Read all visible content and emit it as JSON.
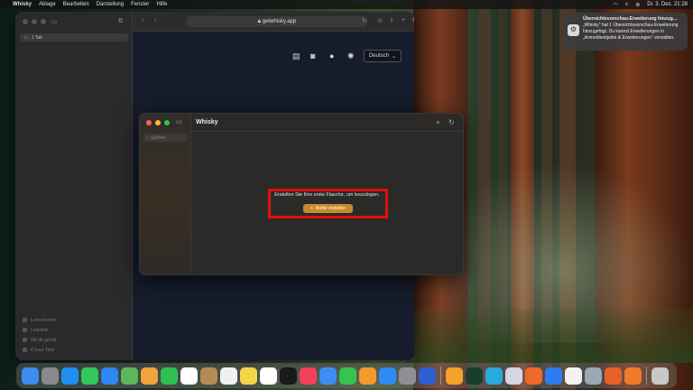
{
  "menubar": {
    "app_name": "Whisky",
    "menus": [
      "Ablage",
      "Bearbeiten",
      "Darstellung",
      "Fenster",
      "Hilfe"
    ],
    "datetime": "Di. 3. Dez.  21:28"
  },
  "safari": {
    "sidebar_tab": "1 Tab",
    "url": "getwhisky.app",
    "sidebar_bottom": [
      "Leseziechen",
      "Leseliste",
      "Mit dir geteilt",
      "iCloud-Tabs"
    ],
    "language_select": "Deutsch"
  },
  "whisky": {
    "title": "Whisky",
    "search_placeholder": "Suchen",
    "empty_message": "Erstellen Sie Ihre erste Flasche, um loszulegen.",
    "create_button_label": "Bottle erstellen"
  },
  "notification": {
    "title": "Übersichtsvorschau-Erweiterung hinzug…",
    "body": "„Whisky“ hat 1 Übersichtsvorschau-Erweiterung hinzugefügt. Du kannst Erweiterungen in „Anmeldeobjekte & Erweiterungen“ verwalten."
  },
  "dock": {
    "apps": [
      {
        "name": "finder-icon",
        "color": "#3c8ef0"
      },
      {
        "name": "launchpad-icon",
        "color": "#8a8a8a"
      },
      {
        "name": "safari-icon",
        "color": "#1f8ff0"
      },
      {
        "name": "messages-icon",
        "color": "#33c859"
      },
      {
        "name": "mail-icon",
        "color": "#2e87f5"
      },
      {
        "name": "maps-icon",
        "color": "#5cb85c"
      },
      {
        "name": "photos-icon",
        "color": "#f2a33a"
      },
      {
        "name": "facetime-icon",
        "color": "#2fc052"
      },
      {
        "name": "calendar-icon",
        "color": "#ffffff"
      },
      {
        "name": "contacts-icon",
        "color": "#b58a55"
      },
      {
        "name": "reminders-icon",
        "color": "#f0f0f0"
      },
      {
        "name": "notes-icon",
        "color": "#f7d54a"
      },
      {
        "name": "freeform-icon",
        "color": "#ffffff"
      },
      {
        "name": "tv-icon",
        "color": "#1a1a1a"
      },
      {
        "name": "music-icon",
        "color": "#f5405a"
      },
      {
        "name": "keynote-icon",
        "color": "#3b8ef0"
      },
      {
        "name": "numbers-icon",
        "color": "#34c34f"
      },
      {
        "name": "pages-icon",
        "color": "#f39a2a"
      },
      {
        "name": "app-store-icon",
        "color": "#2b8cf3"
      },
      {
        "name": "system-settings-icon",
        "color": "#8e8e93"
      },
      {
        "name": "cube-app-icon",
        "color": "#2f5fd0"
      },
      {
        "name": "pencil-app-icon",
        "color": "#f3a12a"
      },
      {
        "name": "xcode-cloud-icon",
        "color": "#1c3d2e"
      },
      {
        "name": "window-app-icon",
        "color": "#2aa8e0"
      },
      {
        "name": "puzzle-app-icon",
        "color": "#d6d6e0"
      },
      {
        "name": "game-app-icon",
        "color": "#f0682a"
      },
      {
        "name": "xcode-icon",
        "color": "#2f7cf0"
      },
      {
        "name": "textedit-icon",
        "color": "#f2f2f2"
      },
      {
        "name": "utility-app-icon",
        "color": "#9aa7b5"
      },
      {
        "name": "office-app-icon",
        "color": "#e9612a"
      },
      {
        "name": "preview-icon",
        "color": "#f07b2a"
      },
      {
        "name": "trash-icon",
        "color": "#c8c8c8"
      }
    ]
  }
}
